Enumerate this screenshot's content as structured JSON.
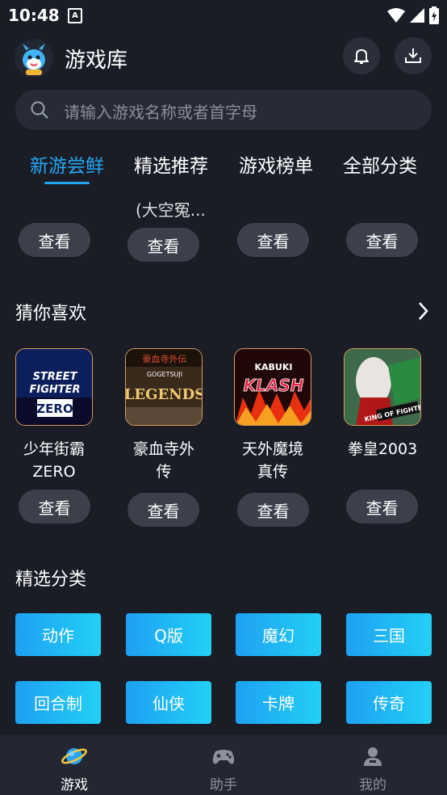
{
  "status_bar": {
    "time": "10:48",
    "notification_icon_label": "A"
  },
  "header": {
    "title": "游戏库"
  },
  "search": {
    "placeholder": "请输入游戏名称或者首字母"
  },
  "tabs": [
    {
      "label": "新游尝鲜",
      "active": true
    },
    {
      "label": "精选推荐",
      "active": false
    },
    {
      "label": "游戏榜单",
      "active": false
    },
    {
      "label": "全部分类",
      "active": false
    }
  ],
  "top_row": {
    "partial_text": "(大空冤...",
    "buttons": [
      "查看",
      "查看",
      "查看",
      "查看"
    ]
  },
  "guess": {
    "title": "猜你喜欢",
    "games": [
      {
        "name_line1": "少年街霸",
        "name_line2": "ZERO",
        "button": "查看",
        "cover_text": "STREET FIGHTER ZERO"
      },
      {
        "name_line1": "豪血寺外",
        "name_line2": "传",
        "button": "查看",
        "cover_text": "LEGENDS"
      },
      {
        "name_line1": "天外魔境",
        "name_line2": "真传",
        "button": "查看",
        "cover_text": "KABUKI KLASH"
      },
      {
        "name_line1": "拳皇2003",
        "name_line2": "",
        "button": "查看",
        "cover_text": "KING OF FIGHTERS"
      }
    ]
  },
  "categories": {
    "title": "精选分类",
    "items": [
      "动作",
      "Q版",
      "魔幻",
      "三国",
      "回合制",
      "仙侠",
      "卡牌",
      "传奇"
    ]
  },
  "bottom_nav": [
    {
      "label": "游戏",
      "icon": "planet-icon",
      "active": true
    },
    {
      "label": "助手",
      "icon": "gamepad-icon",
      "active": false
    },
    {
      "label": "我的",
      "icon": "user-icon",
      "active": false
    }
  ],
  "colors": {
    "accent": "#23a7f5",
    "background": "#1a1d26",
    "button_bg": "#3c404b"
  }
}
